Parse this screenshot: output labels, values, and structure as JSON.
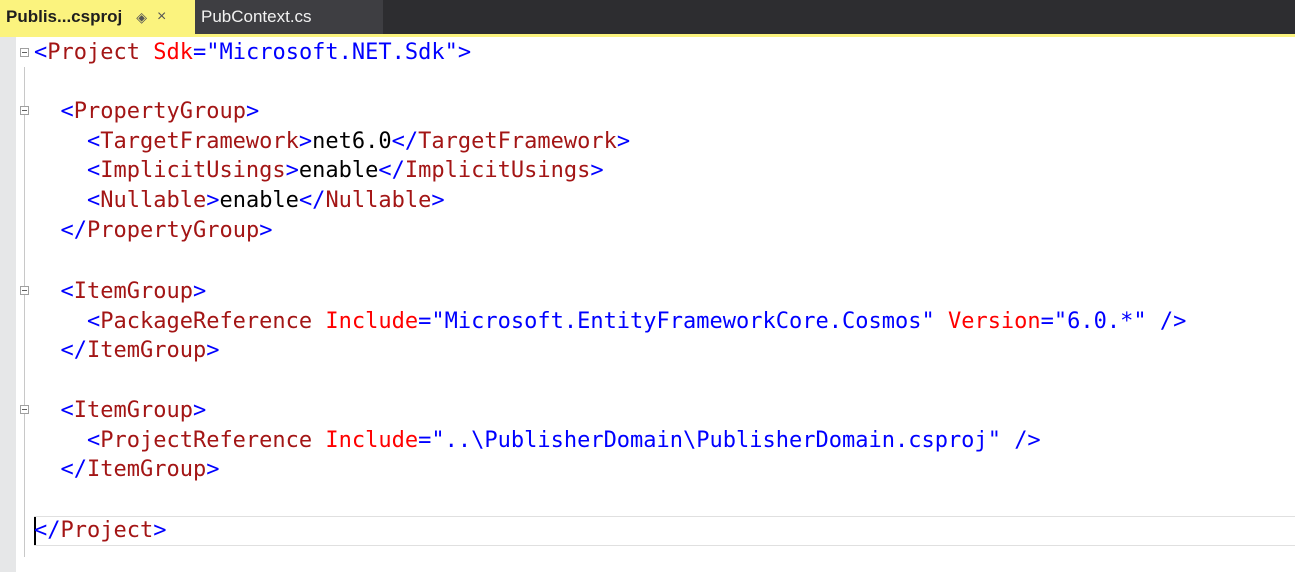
{
  "tabs": [
    {
      "label": "Publis...csproj",
      "active": true,
      "pin_icon": "pin-icon",
      "close_icon": "close-icon"
    },
    {
      "label": "PubContext.cs",
      "active": false
    }
  ],
  "colors": {
    "tab_active_bg": "#fbf37e",
    "tab_bar_bg": "#2d2d30",
    "xml_delimiter": "#0000ff",
    "xml_tag": "#a31515",
    "xml_attribute": "#ff0000",
    "xml_value": "#0000ff"
  },
  "code": {
    "l1": {
      "open": "<",
      "tag": "Project",
      "sp": " ",
      "attr": "Sdk",
      "eq": "=",
      "q1": "\"",
      "val": "Microsoft.NET.Sdk",
      "q2": "\"",
      "close": ">"
    },
    "l3": {
      "indent": "  ",
      "open": "<",
      "tag": "PropertyGroup",
      "close": ">"
    },
    "l4": {
      "indent": "    ",
      "open": "<",
      "tag": "TargetFramework",
      "close": ">",
      "text": "net6.0",
      "eopen": "</",
      "etag": "TargetFramework",
      "eclose": ">"
    },
    "l5": {
      "indent": "    ",
      "open": "<",
      "tag": "ImplicitUsings",
      "close": ">",
      "text": "enable",
      "eopen": "</",
      "etag": "ImplicitUsings",
      "eclose": ">"
    },
    "l6": {
      "indent": "    ",
      "open": "<",
      "tag": "Nullable",
      "close": ">",
      "text": "enable",
      "eopen": "</",
      "etag": "Nullable",
      "eclose": ">"
    },
    "l7": {
      "indent": "  ",
      "open": "</",
      "tag": "PropertyGroup",
      "close": ">"
    },
    "l9": {
      "indent": "  ",
      "open": "<",
      "tag": "ItemGroup",
      "close": ">"
    },
    "l10": {
      "indent": "    ",
      "open": "<",
      "tag": "PackageReference",
      "sp1": " ",
      "attr1": "Include",
      "eq1": "=",
      "q1a": "\"",
      "val1": "Microsoft.EntityFrameworkCore.Cosmos",
      "q1b": "\"",
      "sp2": " ",
      "attr2": "Version",
      "eq2": "=",
      "q2a": "\"",
      "val2": "6.0.*",
      "q2b": "\"",
      "sp3": " ",
      "close": "/>"
    },
    "l11": {
      "indent": "  ",
      "open": "</",
      "tag": "ItemGroup",
      "close": ">"
    },
    "l13": {
      "indent": "  ",
      "open": "<",
      "tag": "ItemGroup",
      "close": ">"
    },
    "l14": {
      "indent": "    ",
      "open": "<",
      "tag": "ProjectReference",
      "sp1": " ",
      "attr1": "Include",
      "eq1": "=",
      "q1a": "\"",
      "val1": "..\\PublisherDomain\\PublisherDomain.csproj",
      "q1b": "\"",
      "sp3": " ",
      "close": "/>"
    },
    "l15": {
      "indent": "  ",
      "open": "</",
      "tag": "ItemGroup",
      "close": ">"
    },
    "l17": {
      "open": "</",
      "tag": "Project",
      "close": ">"
    }
  }
}
